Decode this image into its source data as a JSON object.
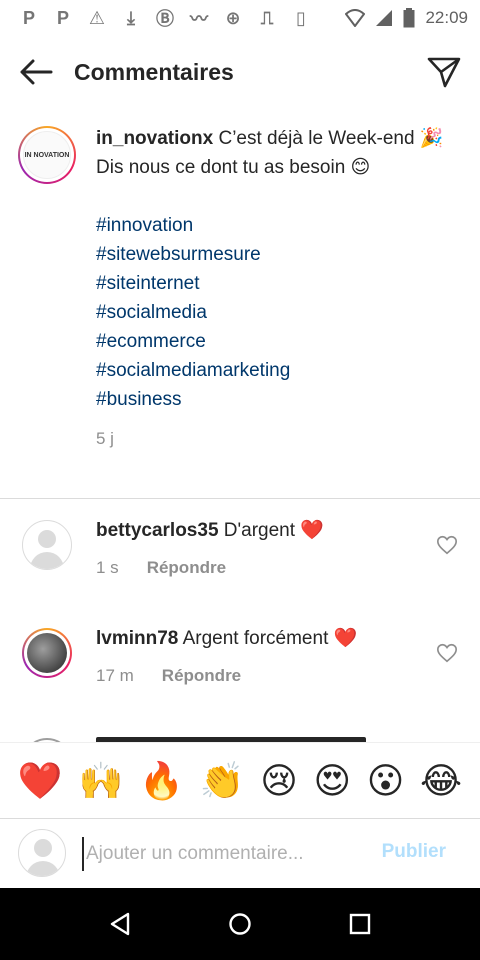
{
  "status_bar": {
    "time": "22:09",
    "icons": [
      "p-icon",
      "p-icon",
      "warning-icon",
      "download-icon",
      "b-icon",
      "activity-icon",
      "add-circle-icon",
      "cast-icon",
      "vibrate-icon",
      "wifi-icon",
      "signal-icon",
      "battery-icon"
    ],
    "letters": [
      "P",
      "P",
      "⚠",
      "⤓",
      "Ⓑ",
      "〰",
      "⊕",
      "⎍",
      "▯"
    ]
  },
  "header": {
    "title": "Commentaires"
  },
  "caption": {
    "username": "in_novationx",
    "text_line": "C’est déjà le Week-end 🎉",
    "text_line2": "Dis nous ce dont tu as besoin 😊",
    "hashtags": [
      "#innovation",
      "#sitewebsurmesure",
      "#siteinternet",
      "#socialmedia",
      "#ecommerce",
      "#socialmediamarketing",
      "#business"
    ],
    "time": "5 j",
    "avatar_label": "IN NOVATION"
  },
  "comments": [
    {
      "username": "bettycarlos35",
      "text": "D'argent ❤️",
      "time": "1 s",
      "reply_label": "Répondre"
    },
    {
      "username": "lvminn78",
      "text": "Argent forcément ❤️",
      "time": "17 m",
      "reply_label": "Répondre"
    }
  ],
  "emoji_bar": {
    "emojis": [
      "❤️",
      "🙌",
      "🔥",
      "👏",
      "😢",
      "😍",
      "😮",
      "😂"
    ]
  },
  "input": {
    "placeholder": "Ajouter un commentaire...",
    "value": "",
    "publish_label": "Publier"
  },
  "colors": {
    "hashtag": "#00376b",
    "publish_disabled": "#b2dffc",
    "meta_gray": "#8e8e8e",
    "heart_red": "#ed4956"
  }
}
